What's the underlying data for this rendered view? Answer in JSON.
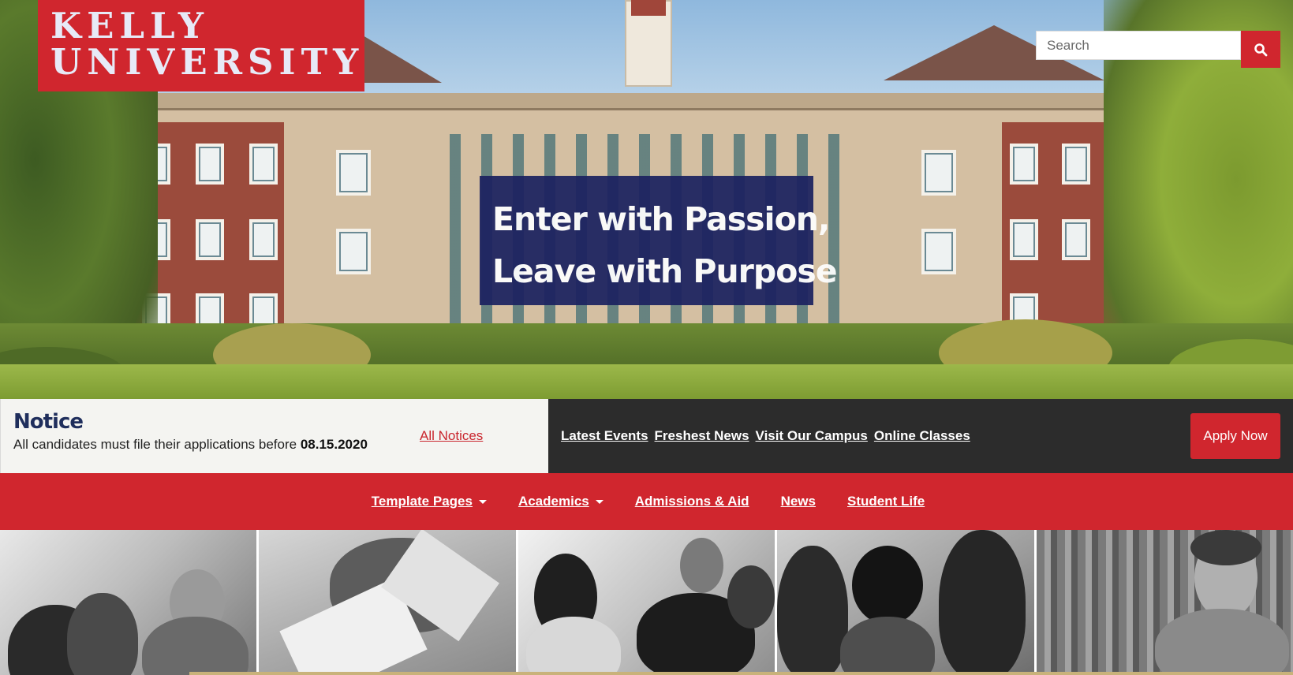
{
  "brand": {
    "line1": "KELLY",
    "line2": "UNIVERSITY",
    "primary_color": "#d0262e",
    "navy_color": "#1c2260"
  },
  "search": {
    "placeholder": "Search",
    "icon": "search-icon"
  },
  "hero": {
    "tagline_line1": "Enter with Passion,",
    "tagline_line2": "Leave with Purpose"
  },
  "notice": {
    "title": "Notice",
    "text": "All candidates must file their applications before",
    "date": "08.15.2020",
    "all_notices_label": "All Notices"
  },
  "quick_links": [
    "Latest Events",
    "Freshest News",
    "Visit Our Campus",
    "Online Classes"
  ],
  "apply_button": "Apply Now",
  "main_nav": [
    {
      "label": "Template Pages",
      "dropdown": true
    },
    {
      "label": "Academics",
      "dropdown": true
    },
    {
      "label": "Admissions & Aid",
      "dropdown": false
    },
    {
      "label": "News",
      "dropdown": false
    },
    {
      "label": "Student Life",
      "dropdown": false
    }
  ]
}
